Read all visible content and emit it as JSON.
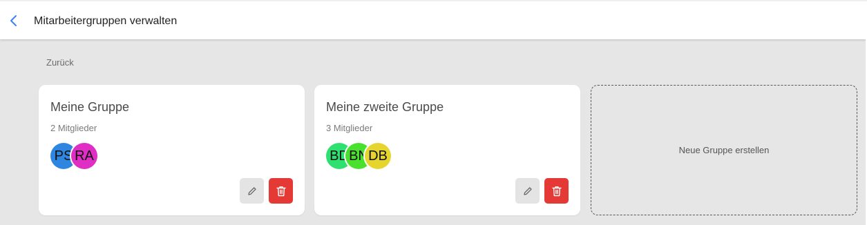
{
  "header": {
    "title": "Mitarbeitergruppen verwalten",
    "back_icon": "chevron-left-icon"
  },
  "back_link": "Zurück",
  "groups": [
    {
      "name": "Meine Gruppe",
      "members_label": "2 Mitglieder",
      "avatars": [
        {
          "initials": "PS",
          "color": "#2e86e0"
        },
        {
          "initials": "RA",
          "color": "#e02ec4"
        }
      ]
    },
    {
      "name": "Meine zweite Gruppe",
      "members_label": "3 Mitglieder",
      "avatars": [
        {
          "initials": "BD",
          "color": "#2ee06f"
        },
        {
          "initials": "BN",
          "color": "#4ae02e"
        },
        {
          "initials": "DB",
          "color": "#e6d52e"
        }
      ]
    }
  ],
  "actions": {
    "edit_icon": "pencil-icon",
    "delete_icon": "trash-icon",
    "delete_color": "#e53935"
  },
  "new_group": {
    "label": "Neue Gruppe erstellen"
  }
}
